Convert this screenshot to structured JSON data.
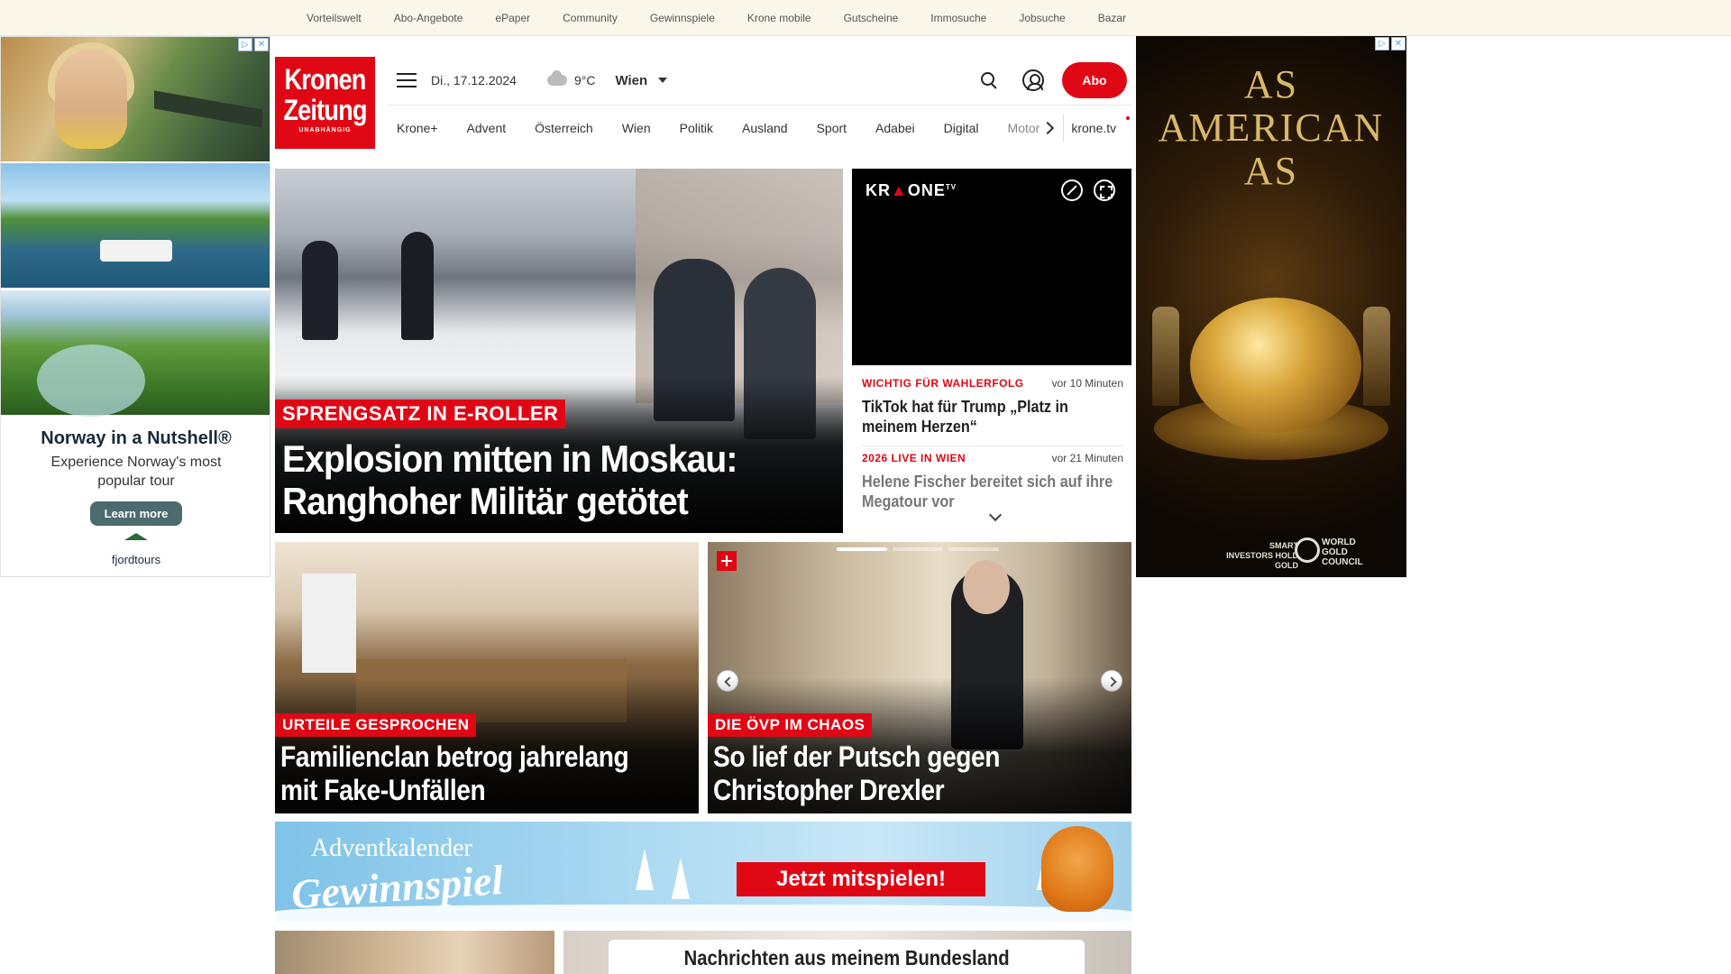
{
  "topbar": {
    "links": [
      "Vorteilswelt",
      "Abo-Angebote",
      "ePaper",
      "Community",
      "Gewinnspiele",
      "Krone mobile",
      "Gutscheine",
      "Immosuche",
      "Jobsuche",
      "Bazar"
    ]
  },
  "logo": {
    "line1": "Kronen",
    "line2": "Zeitung",
    "tagline": "UNABHÄNGIG"
  },
  "header": {
    "date": "Di., 17.12.2024",
    "temperature": "9°C",
    "weather_icon": "cloud-icon",
    "city": "Wien",
    "abo_label": "Abo"
  },
  "nav": {
    "items": [
      "Krone+",
      "Advent",
      "Österreich",
      "Wien",
      "Politik",
      "Ausland",
      "Sport",
      "Adabei",
      "Digital",
      "Motor"
    ],
    "krone_tv": "krone.tv"
  },
  "lead": {
    "kicker": "SPRENGSATZ IN E-ROLLER",
    "headline": "Explosion mitten in Moskau: Ranghoher Militär getötet"
  },
  "video": {
    "brand_left": "KR",
    "brand_right": "ONE",
    "brand_sup": "TV"
  },
  "news": [
    {
      "kicker": "WICHTIG FÜR WAHLERFOLG",
      "time": "vor 10 Minuten",
      "headline": "TikTok hat für Trump „Platz in meinem Herzen“"
    },
    {
      "kicker": "2026 LIVE IN WIEN",
      "time": "vor 21 Minuten",
      "headline": "Helene Fischer bereitet sich auf ihre Megatour vor"
    }
  ],
  "teasers": [
    {
      "kicker": "URTEILE GESPROCHEN",
      "headline": "Familienclan betrog jahrelang mit Fake-Unfällen"
    },
    {
      "kicker": "DIE ÖVP IM CHAOS",
      "headline": "So lief der Putsch gegen Christopher Drexler"
    }
  ],
  "advent": {
    "line1": "Adventkalender",
    "line2": "Gewinnspiel",
    "cta": "Jetzt mitspielen!"
  },
  "bottom": {
    "title": "Nachrichten aus meinem Bundesland"
  },
  "ad_left": {
    "title": "Norway in a Nutshell®",
    "text": "Experience Norway's most popular tour",
    "cta": "Learn more",
    "brand": "fjordtours"
  },
  "ad_right": {
    "headline": "AS AMERICAN AS",
    "tagline": "SMART INVESTORS HOLD GOLD",
    "brand": "WORLD GOLD COUNCIL"
  },
  "colors": {
    "brand_red": "#e00715",
    "topbar_bg": "#faf6ea"
  }
}
